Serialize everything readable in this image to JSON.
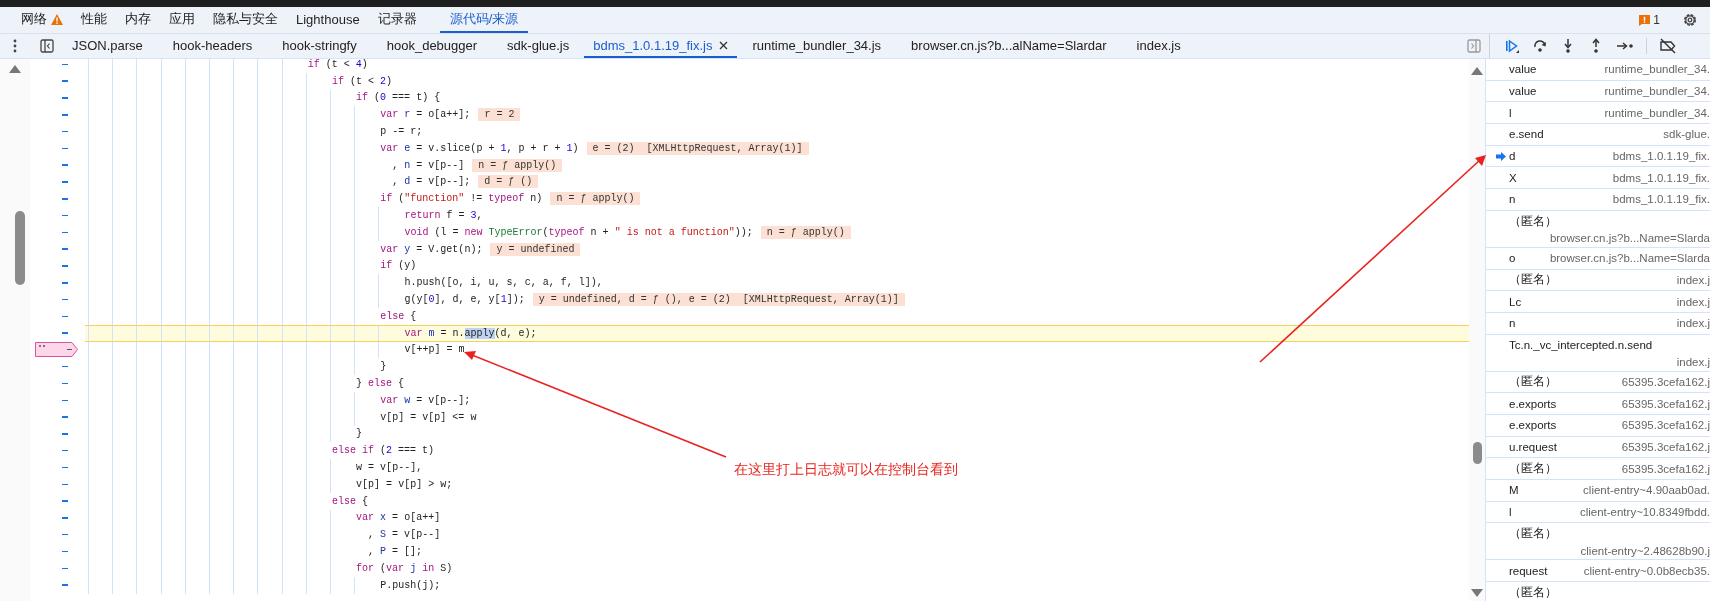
{
  "panel_tabs": [
    {
      "label": "网络",
      "warning": true,
      "selected": false
    },
    {
      "label": "性能",
      "warning": false,
      "selected": false
    },
    {
      "label": "内存",
      "warning": false,
      "selected": false
    },
    {
      "label": "应用",
      "warning": false,
      "selected": false
    },
    {
      "label": "隐私与安全",
      "warning": false,
      "selected": false
    },
    {
      "label": "Lighthouse",
      "warning": false,
      "selected": false
    },
    {
      "label": "记录器",
      "warning": false,
      "selected": false
    },
    {
      "label": "源代码/来源",
      "warning": false,
      "selected": true
    }
  ],
  "issues_count": "1",
  "file_tabs": [
    {
      "label": "JSON.parse",
      "selected": false
    },
    {
      "label": "hook-headers",
      "selected": false
    },
    {
      "label": "hook-stringfy",
      "selected": false
    },
    {
      "label": "hook_debugger",
      "selected": false
    },
    {
      "label": "sdk-glue.js",
      "selected": false
    },
    {
      "label": "bdms_1.0.1.19_fix.js",
      "selected": true
    },
    {
      "label": "runtime_bundler_34.js",
      "selected": false
    },
    {
      "label": "browser.cn.js?b...alName=Slardar",
      "selected": false
    },
    {
      "label": "index.js",
      "selected": false
    }
  ],
  "code_lines": [
    {
      "code": "if (t < 4)",
      "paused": false,
      "breakpoint": false,
      "children": [
        {
          "code": "if (t < 2)",
          "paused": false,
          "breakpoint": false,
          "children": [
            {
              "code": "if (0 === t) {",
              "paused": false,
              "breakpoint": false,
              "children": [
                {
                  "code": "var r = o[a++];",
                  "value": "r = 2",
                  "paused": false,
                  "breakpoint": false
                },
                {
                  "code": "p -= r;",
                  "paused": false,
                  "breakpoint": false
                },
                {
                  "code": "var e = v.slice(p + 1, p + r + 1)",
                  "value": "e = (2)  [XMLHttpRequest, Array(1)]",
                  "paused": false,
                  "breakpoint": false
                },
                {
                  "code": "  , n = v[p--]",
                  "value": "n = ƒ apply()",
                  "paused": false,
                  "breakpoint": false
                },
                {
                  "code": "  , d = v[p--];",
                  "value": "d = ƒ ()",
                  "paused": false,
                  "breakpoint": false
                },
                {
                  "code": "if (\"function\" != typeof n)",
                  "value": "n = ƒ apply()",
                  "paused": false,
                  "breakpoint": false,
                  "children": [
                    {
                      "code": "return f = 3,",
                      "paused": false,
                      "breakpoint": false
                    },
                    {
                      "code": "void (l = new TypeError(typeof n + \" is not a function\"));",
                      "value": "n = ƒ apply()",
                      "paused": false,
                      "breakpoint": false
                    }
                  ]
                },
                {
                  "code": "var y = V.get(n);",
                  "value": "y = undefined",
                  "paused": false,
                  "breakpoint": false
                },
                {
                  "code": "if (y)",
                  "paused": false,
                  "breakpoint": false,
                  "children": [
                    {
                      "code": "h.push([o, i, u, s, c, a, f, l]),",
                      "paused": false,
                      "breakpoint": false
                    },
                    {
                      "code": "g(y[0], d, e, y[1]);",
                      "value": "y = undefined, d = ƒ (), e = (2)  [XMLHttpRequest, Array(1)]",
                      "paused": false,
                      "breakpoint": false
                    }
                  ]
                },
                {
                  "code": "else {",
                  "paused": false,
                  "breakpoint": false,
                  "children": [
                    {
                      "segments": [
                        {
                          "text": "var m = n.",
                          "selected": false
                        },
                        {
                          "text": "apply",
                          "selected": true
                        },
                        {
                          "text": "(d, e);",
                          "selected": false
                        }
                      ],
                      "paused": true,
                      "breakpoint": false
                    },
                    {
                      "code": "v[++p] = m",
                      "paused": false,
                      "breakpoint": true
                    }
                  ]
                },
                {
                  "code": "}",
                  "paused": false,
                  "breakpoint": false
                }
              ]
            },
            {
              "code": "} else {",
              "paused": false,
              "breakpoint": false,
              "children": [
                {
                  "code": "var w = v[p--];",
                  "paused": false,
                  "breakpoint": false
                },
                {
                  "code": "v[p] = v[p] <= w",
                  "paused": false,
                  "breakpoint": false
                }
              ]
            },
            {
              "code": "}",
              "paused": false,
              "breakpoint": false
            }
          ]
        },
        {
          "code": "else if (2 === t)",
          "paused": false,
          "breakpoint": false,
          "children": [
            {
              "code": "w = v[p--],",
              "paused": false,
              "breakpoint": false
            },
            {
              "code": "v[p] = v[p] > w;",
              "paused": false,
              "breakpoint": false
            }
          ]
        },
        {
          "code": "else {",
          "paused": false,
          "breakpoint": false,
          "children": [
            {
              "code": "var x = o[a++]",
              "paused": false,
              "breakpoint": false
            },
            {
              "code": "  , S = v[p--]",
              "paused": false,
              "breakpoint": false
            },
            {
              "code": "  , P = [];",
              "paused": false,
              "breakpoint": false
            },
            {
              "code": "for (var j in S)",
              "paused": false,
              "breakpoint": false,
              "children": [
                {
                  "code": "P.push(j);",
                  "paused": false,
                  "breakpoint": false
                }
              ]
            }
          ]
        }
      ]
    }
  ],
  "annotation": {
    "text": "在这里打上日志就可以在控制台看到"
  },
  "call_stack": [
    {
      "name": "value",
      "file": "runtime_bundler_34.",
      "kind": "inline",
      "selected": false
    },
    {
      "name": "value",
      "file": "runtime_bundler_34.",
      "kind": "inline",
      "selected": false
    },
    {
      "name": "l",
      "file": "runtime_bundler_34.",
      "kind": "inline",
      "selected": false
    },
    {
      "name": "e.send",
      "file": "sdk-glue.",
      "kind": "inline",
      "selected": false
    },
    {
      "name": "d",
      "file": "bdms_1.0.1.19_fix.",
      "kind": "inline",
      "selected": true
    },
    {
      "name": "X",
      "file": "bdms_1.0.1.19_fix.",
      "kind": "inline",
      "selected": false
    },
    {
      "name": "n",
      "file": "bdms_1.0.1.19_fix.",
      "kind": "inline",
      "selected": false
    },
    {
      "name": "（匿名）",
      "file": "browser.cn.js?b...Name=Slarda",
      "kind": "wrapped",
      "selected": false
    },
    {
      "name": "o",
      "file": "browser.cn.js?b...Name=Slarda",
      "kind": "inline",
      "selected": false
    },
    {
      "name": "（匿名）",
      "file": "index.j",
      "kind": "inline",
      "selected": false
    },
    {
      "name": "Lc",
      "file": "index.j",
      "kind": "inline",
      "selected": false
    },
    {
      "name": "n",
      "file": "index.j",
      "kind": "inline",
      "selected": false
    },
    {
      "name": "Tc.n._vc_intercepted.n.send",
      "file": "index.j",
      "kind": "wrapped",
      "selected": false
    },
    {
      "name": "（匿名）",
      "file": "65395.3cefa162.j",
      "kind": "inline",
      "selected": false
    },
    {
      "name": "e.exports",
      "file": "65395.3cefa162.j",
      "kind": "inline",
      "selected": false
    },
    {
      "name": "e.exports",
      "file": "65395.3cefa162.j",
      "kind": "inline",
      "selected": false
    },
    {
      "name": "u.request",
      "file": "65395.3cefa162.j",
      "kind": "inline",
      "selected": false
    },
    {
      "name": "（匿名）",
      "file": "65395.3cefa162.j",
      "kind": "inline",
      "selected": false
    },
    {
      "name": "M",
      "file": "client-entry~4.90aab0ad.",
      "kind": "inline",
      "selected": false
    },
    {
      "name": "l",
      "file": "client-entry~10.8349fbdd.",
      "kind": "inline",
      "selected": false
    },
    {
      "name": "（匿名）",
      "file": "client-entry~2.48628b90.j",
      "kind": "wrapped",
      "selected": false
    },
    {
      "name": "request",
      "file": "client-entry~0.0b8ecb35.",
      "kind": "inline",
      "selected": false
    },
    {
      "name": "（匿名）",
      "kind": "inline",
      "selected": false
    }
  ]
}
